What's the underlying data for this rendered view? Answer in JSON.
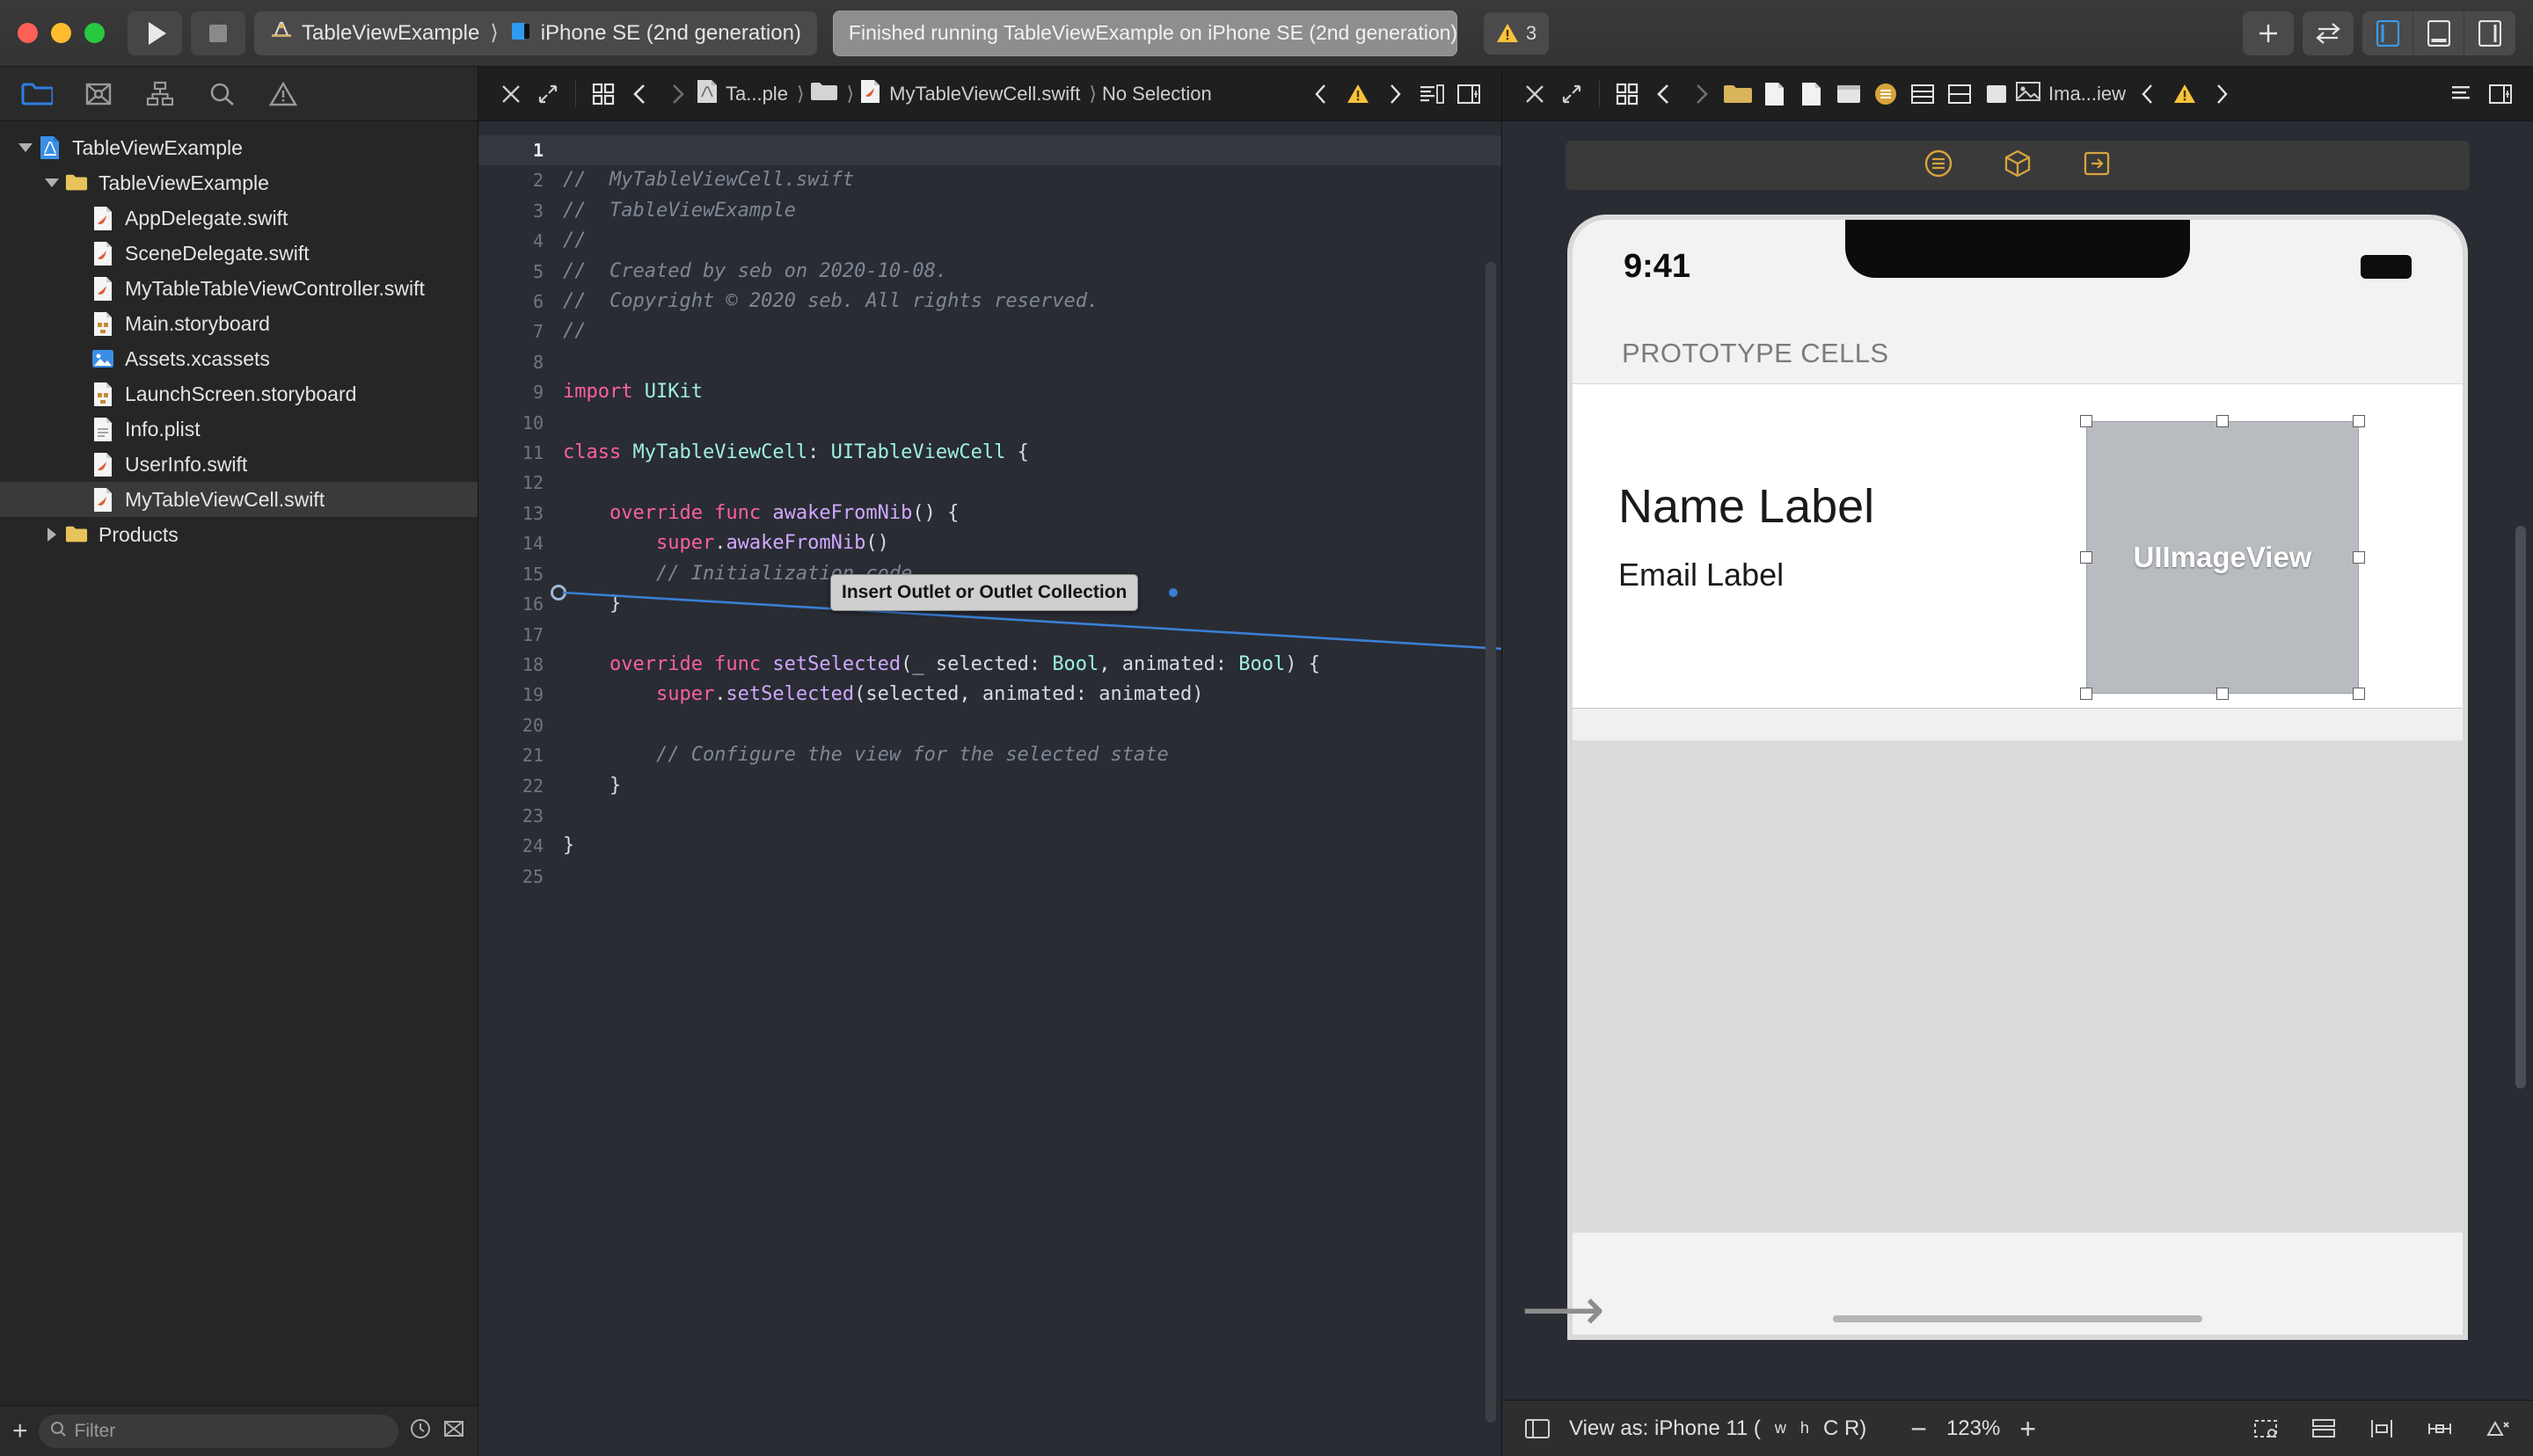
{
  "window": {
    "titlebar": {
      "traffic_lights": [
        "close",
        "minimize",
        "zoom"
      ],
      "run_button_label": "Run",
      "stop_button_label": "Stop",
      "scheme_name": "TableViewExample",
      "destination_name": "iPhone SE (2nd generation)",
      "status_text": "Finished running TableViewExample on iPhone SE (2nd generation)",
      "warning_count": "3",
      "add_button_label": "+",
      "code_review_label": "Code Review",
      "editor_toggles": [
        "navigator",
        "debug-area",
        "inspector"
      ]
    }
  },
  "navigator": {
    "tabs": [
      {
        "name": "project-navigator",
        "icon": "folder-icon",
        "selected": true
      },
      {
        "name": "source-control-navigator",
        "icon": "source-control-icon",
        "selected": false
      },
      {
        "name": "symbol-navigator",
        "icon": "hierarchy-icon",
        "selected": false
      },
      {
        "name": "find-navigator",
        "icon": "search-icon",
        "selected": false
      },
      {
        "name": "issue-navigator",
        "icon": "warning-triangle-icon",
        "selected": false
      }
    ],
    "tree": [
      {
        "label": "TableViewExample",
        "icon": "xcode-project-icon",
        "indent": 0,
        "disclosure": "down",
        "selected": false
      },
      {
        "label": "TableViewExample",
        "icon": "folder-icon",
        "indent": 1,
        "disclosure": "down",
        "selected": false
      },
      {
        "label": "AppDelegate.swift",
        "icon": "swift-file-icon",
        "indent": 2,
        "disclosure": "none",
        "selected": false
      },
      {
        "label": "SceneDelegate.swift",
        "icon": "swift-file-icon",
        "indent": 2,
        "disclosure": "none",
        "selected": false
      },
      {
        "label": "MyTableTableViewController.swift",
        "icon": "swift-file-icon",
        "indent": 2,
        "disclosure": "none",
        "selected": false
      },
      {
        "label": "Main.storyboard",
        "icon": "storyboard-icon",
        "indent": 2,
        "disclosure": "none",
        "selected": false
      },
      {
        "label": "Assets.xcassets",
        "icon": "assets-icon",
        "indent": 2,
        "disclosure": "none",
        "selected": false
      },
      {
        "label": "LaunchScreen.storyboard",
        "icon": "storyboard-icon",
        "indent": 2,
        "disclosure": "none",
        "selected": false
      },
      {
        "label": "Info.plist",
        "icon": "plist-icon",
        "indent": 2,
        "disclosure": "none",
        "selected": false
      },
      {
        "label": "UserInfo.swift",
        "icon": "swift-file-icon",
        "indent": 2,
        "disclosure": "none",
        "selected": false
      },
      {
        "label": "MyTableViewCell.swift",
        "icon": "swift-file-icon",
        "indent": 2,
        "disclosure": "none",
        "selected": true
      },
      {
        "label": "Products",
        "icon": "folder-icon",
        "indent": 1,
        "disclosure": "right",
        "selected": false
      }
    ],
    "filter": {
      "placeholder": "Filter",
      "value": "",
      "add_label": "+",
      "recent_icon": "clock-icon",
      "filter_icon": "filter-icon"
    }
  },
  "editor": {
    "jumpbar": {
      "close_icon": "close-icon",
      "expand_icon": "expand-icon",
      "related_icon": "related-items-icon",
      "back_icon": "chevron-left-icon",
      "forward_icon": "chevron-right-icon",
      "crumb_project": "Ta...ple",
      "crumb_folder": "folder-icon",
      "crumb_file": "MyTableViewCell.swift",
      "crumb_selection": "No Selection",
      "issue_prev_icon": "chevron-left-icon",
      "issue_warning_icon": "warning-triangle-icon",
      "issue_next_icon": "chevron-right-icon",
      "minimap_icon": "minimap-icon",
      "split_icon": "split-editor-icon"
    },
    "filename": "MyTableViewCell.swift",
    "current_line": 1,
    "outlet_drag": {
      "tooltip": "Insert Outlet or Outlet Collection",
      "source_line": 13
    },
    "lines": [
      {
        "n": 1,
        "tokens": [
          {
            "t": "//",
            "c": "cmt"
          }
        ]
      },
      {
        "n": 2,
        "tokens": [
          {
            "t": "//  MyTableViewCell.swift",
            "c": "cmt"
          }
        ]
      },
      {
        "n": 3,
        "tokens": [
          {
            "t": "//  TableViewExample",
            "c": "cmt"
          }
        ]
      },
      {
        "n": 4,
        "tokens": [
          {
            "t": "//",
            "c": "cmt"
          }
        ]
      },
      {
        "n": 5,
        "tokens": [
          {
            "t": "//  Created by seb on 2020-10-08.",
            "c": "cmt"
          }
        ]
      },
      {
        "n": 6,
        "tokens": [
          {
            "t": "//  Copyright © 2020 seb. All rights reserved.",
            "c": "cmt"
          }
        ]
      },
      {
        "n": 7,
        "tokens": [
          {
            "t": "//",
            "c": "cmt"
          }
        ]
      },
      {
        "n": 8,
        "tokens": [
          {
            "t": "",
            "c": "id"
          }
        ]
      },
      {
        "n": 9,
        "tokens": [
          {
            "t": "import ",
            "c": "kw"
          },
          {
            "t": "UIKit",
            "c": "typ"
          }
        ]
      },
      {
        "n": 10,
        "tokens": [
          {
            "t": "",
            "c": "id"
          }
        ]
      },
      {
        "n": 11,
        "tokens": [
          {
            "t": "class ",
            "c": "kw"
          },
          {
            "t": "MyTableViewCell",
            "c": "typ"
          },
          {
            "t": ": ",
            "c": "id"
          },
          {
            "t": "UITableViewCell",
            "c": "typ"
          },
          {
            "t": " {",
            "c": "id"
          }
        ]
      },
      {
        "n": 12,
        "tokens": [
          {
            "t": "",
            "c": "id"
          }
        ]
      },
      {
        "n": 13,
        "tokens": [
          {
            "t": "    override func ",
            "c": "kw"
          },
          {
            "t": "awakeFromNib",
            "c": "fn"
          },
          {
            "t": "() {",
            "c": "id"
          }
        ]
      },
      {
        "n": 14,
        "tokens": [
          {
            "t": "        super",
            "c": "kw"
          },
          {
            "t": ".",
            "c": "id"
          },
          {
            "t": "awakeFromNib",
            "c": "fn"
          },
          {
            "t": "()",
            "c": "id"
          }
        ]
      },
      {
        "n": 15,
        "tokens": [
          {
            "t": "        // Initialization code",
            "c": "cmt"
          }
        ]
      },
      {
        "n": 16,
        "tokens": [
          {
            "t": "    }",
            "c": "id"
          }
        ]
      },
      {
        "n": 17,
        "tokens": [
          {
            "t": "",
            "c": "id"
          }
        ]
      },
      {
        "n": 18,
        "tokens": [
          {
            "t": "    override func ",
            "c": "kw"
          },
          {
            "t": "setSelected",
            "c": "fn"
          },
          {
            "t": "(_ selected: ",
            "c": "id"
          },
          {
            "t": "Bool",
            "c": "typ"
          },
          {
            "t": ", animated: ",
            "c": "id"
          },
          {
            "t": "Bool",
            "c": "typ"
          },
          {
            "t": ") {",
            "c": "id"
          }
        ]
      },
      {
        "n": 19,
        "tokens": [
          {
            "t": "        super",
            "c": "kw"
          },
          {
            "t": ".",
            "c": "id"
          },
          {
            "t": "setSelected",
            "c": "fn"
          },
          {
            "t": "(selected, animated: animated)",
            "c": "id"
          }
        ]
      },
      {
        "n": 20,
        "tokens": [
          {
            "t": "",
            "c": "id"
          }
        ]
      },
      {
        "n": 21,
        "tokens": [
          {
            "t": "        // Configure the view for the selected state",
            "c": "cmt"
          }
        ]
      },
      {
        "n": 22,
        "tokens": [
          {
            "t": "    }",
            "c": "id"
          }
        ]
      },
      {
        "n": 23,
        "tokens": [
          {
            "t": "",
            "c": "id"
          }
        ]
      },
      {
        "n": 24,
        "tokens": [
          {
            "t": "}",
            "c": "id"
          }
        ]
      },
      {
        "n": 25,
        "tokens": [
          {
            "t": "",
            "c": "id"
          }
        ]
      }
    ]
  },
  "interface_builder": {
    "jumpbar": {
      "close_icon": "close-icon",
      "expand_icon": "expand-icon",
      "related_icon": "related-items-icon",
      "back_icon": "chevron-left-icon",
      "forward_icon": "chevron-right-icon",
      "crumb_file": "Ima...iew",
      "issue_prev_icon": "chevron-left-icon",
      "issue_warning_icon": "warning-triangle-icon",
      "issue_next_icon": "chevron-right-icon",
      "minimap_icon": "minimap-icon",
      "split_icon": "split-editor-icon"
    },
    "canvas_toolbar": [
      {
        "name": "document-outline-toggle",
        "icon": "outline-icon"
      },
      {
        "name": "view-as-3d-toggle",
        "icon": "cube-icon"
      },
      {
        "name": "embed-in-toggle",
        "icon": "embed-icon"
      }
    ],
    "device": {
      "status_time": "9:41",
      "battery_icon": "battery-icon"
    },
    "scene": {
      "section_header": "PROTOTYPE CELLS",
      "cell": {
        "name_label": "Name Label",
        "email_label": "Email Label",
        "imageview_label": "UIImageView",
        "selected_element": "UIImageView"
      }
    },
    "statusbar": {
      "outline_toggle_icon": "outline-icon",
      "view_as_label": "View as: iPhone 11 (",
      "view_as_suffix": "C  R)",
      "size_class_w": "w",
      "size_class_h": "h",
      "zoom_out_label": "−",
      "zoom_level": "123%",
      "zoom_in_label": "+",
      "right_icons": [
        {
          "name": "update-frames-icon"
        },
        {
          "name": "embed-in-icon"
        },
        {
          "name": "align-icon"
        },
        {
          "name": "add-constraints-icon"
        },
        {
          "name": "resolve-issues-icon"
        }
      ]
    }
  },
  "colors": {
    "accent": "#3a8ee6",
    "warning": "#f8c33c",
    "selection": "#3a3a3a",
    "editor_bg": "#292c33",
    "connection_line": "#3a7fd5"
  }
}
